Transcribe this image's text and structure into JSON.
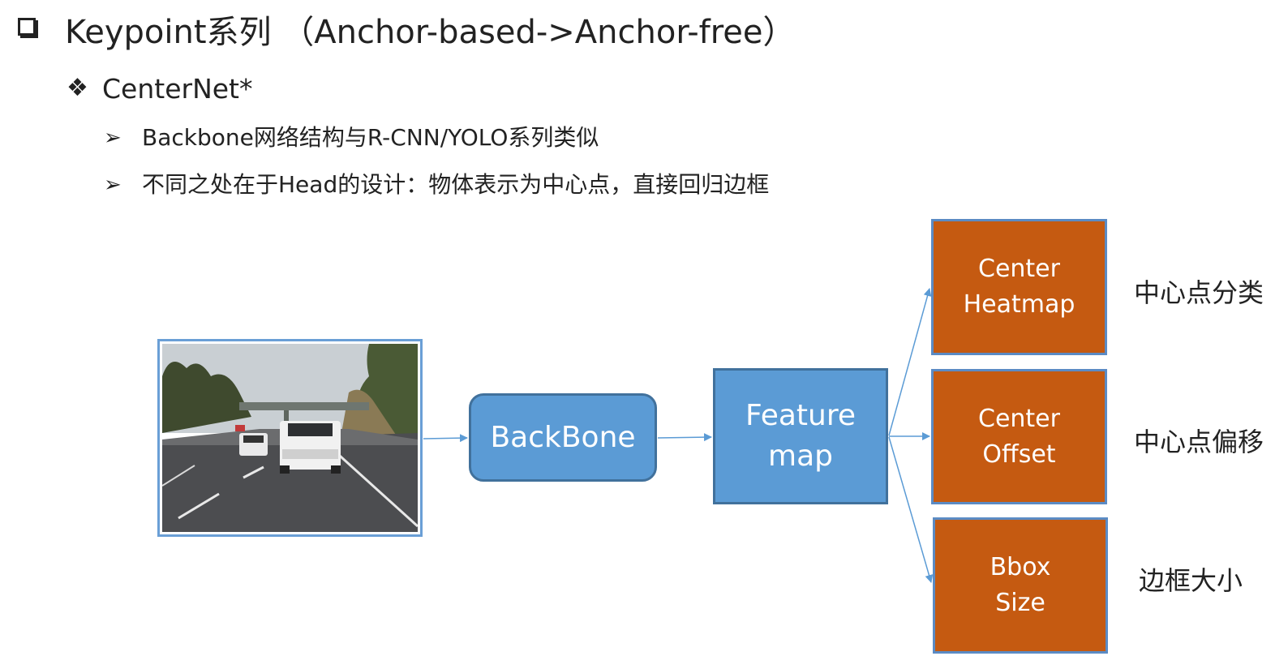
{
  "title": {
    "text": "Keypoint系列 （Anchor-based->Anchor-free）"
  },
  "subtitle": {
    "text": "CenterNet*"
  },
  "bullets": [
    "Backbone网络结构与R-CNN/YOLO系列类似",
    "不同之处在于Head的设计：物体表示为中心点，直接回归边框"
  ],
  "diagram": {
    "backbone_label": "BackBone",
    "feature_line1": "Feature",
    "feature_line2": "map",
    "heads": [
      {
        "line1": "Center",
        "line2": "Heatmap",
        "desc": "中心点分类"
      },
      {
        "line1": "Center",
        "line2": "Offset",
        "desc": "中心点偏移"
      },
      {
        "line1": "Bbox",
        "line2": "Size",
        "desc": "边框大小"
      }
    ]
  },
  "colors": {
    "blue_box": "#5b9bd5",
    "orange_box": "#c55a11",
    "arrow": "#5b9bd5"
  },
  "icons": {
    "h1": "hollow-square-bullet",
    "h2": "four-diamond-bullet",
    "b3": "arrowhead-bullet"
  }
}
